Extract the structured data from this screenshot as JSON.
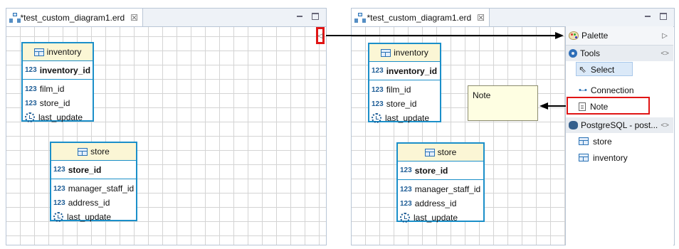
{
  "left_editor": {
    "tab_title": "*test_custom_diagram1.erd",
    "entities": [
      {
        "name": "inventory",
        "pk": {
          "type": "123",
          "name": "inventory_id"
        },
        "columns": [
          {
            "type": "123",
            "name": "film_id"
          },
          {
            "type": "123",
            "name": "store_id"
          },
          {
            "type": "clock",
            "name": "last_update"
          }
        ]
      },
      {
        "name": "store",
        "pk": {
          "type": "123",
          "name": "store_id"
        },
        "columns": [
          {
            "type": "123",
            "name": "manager_staff_id"
          },
          {
            "type": "123",
            "name": "address_id"
          },
          {
            "type": "clock",
            "name": "last_update"
          }
        ]
      }
    ]
  },
  "right_editor": {
    "tab_title": "*test_custom_diagram1.erd",
    "note_text": "Note",
    "entities": [
      {
        "name": "inventory",
        "pk": {
          "type": "123",
          "name": "inventory_id"
        },
        "columns": [
          {
            "type": "123",
            "name": "film_id"
          },
          {
            "type": "123",
            "name": "store_id"
          },
          {
            "type": "clock",
            "name": "last_update"
          }
        ]
      },
      {
        "name": "store",
        "pk": {
          "type": "123",
          "name": "store_id"
        },
        "columns": [
          {
            "type": "123",
            "name": "manager_staff_id"
          },
          {
            "type": "123",
            "name": "address_id"
          },
          {
            "type": "clock",
            "name": "last_update"
          }
        ]
      }
    ]
  },
  "palette": {
    "title": "Palette",
    "tools_drawer": "Tools",
    "tools": [
      "Select",
      "Connection",
      "Note"
    ],
    "selected_tool": "Select",
    "db_drawer": "PostgreSQL - post...",
    "db_items": [
      "store",
      "inventory"
    ]
  },
  "colors": {
    "entity_border": "#1b8fc9",
    "entity_header": "#fbf6d5",
    "highlight": "#e01515",
    "note_bg": "#fefee2"
  }
}
